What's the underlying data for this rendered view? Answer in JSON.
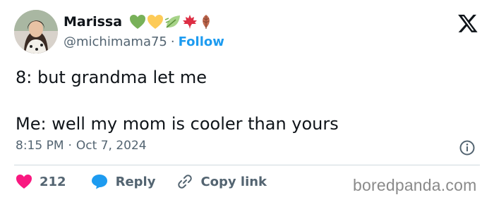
{
  "author": {
    "name": "Marissa",
    "handle": "@michimama75",
    "separator": "·",
    "follow_label": "Follow",
    "emoji_icons": [
      "green-heart-icon",
      "yellow-heart-icon",
      "leaf-fluttering-icon",
      "maple-leaf-icon",
      "fallen-leaf-icon"
    ]
  },
  "tweet": {
    "lines": [
      "8: but grandma let me",
      "Me: well my mom is cooler than yours"
    ]
  },
  "meta": {
    "time": "8:15 PM",
    "separator": "·",
    "date": "Oct 7, 2024"
  },
  "actions": {
    "likes": "212",
    "reply_label": "Reply",
    "copy_label": "Copy link"
  },
  "watermark": "boredpanda.com",
  "colors": {
    "like": "#f91880",
    "reply": "#1d9bf0",
    "follow": "#1d9bf0",
    "muted": "#536471",
    "text": "#0f1419"
  }
}
